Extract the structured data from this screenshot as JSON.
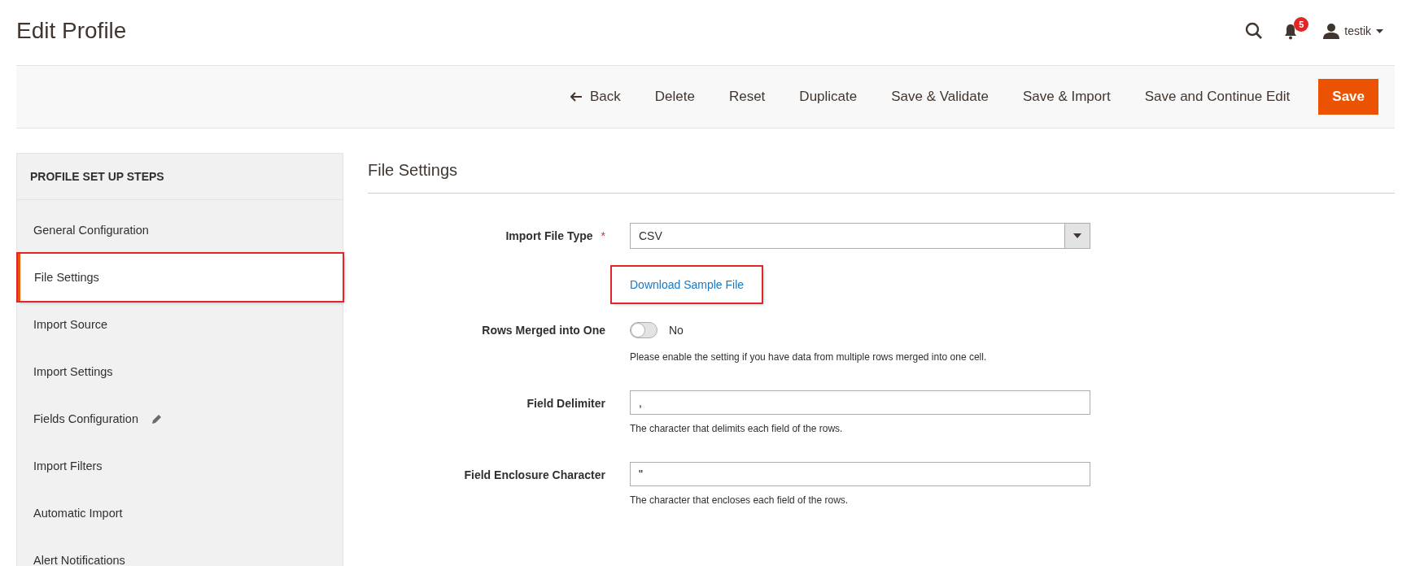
{
  "page_title": "Edit Profile",
  "header": {
    "notification_count": "5",
    "user": "testik"
  },
  "toolbar": {
    "back": "Back",
    "buttons": [
      {
        "label": "Delete",
        "kind": "plain"
      },
      {
        "label": "Reset",
        "kind": "plain"
      },
      {
        "label": "Duplicate",
        "kind": "plain"
      },
      {
        "label": "Save & Validate",
        "kind": "plain"
      },
      {
        "label": "Save & Import",
        "kind": "plain"
      },
      {
        "label": "Save and Continue Edit",
        "kind": "plain"
      },
      {
        "label": "Save",
        "kind": "primary"
      }
    ]
  },
  "sidebar": {
    "title": "PROFILE SET UP STEPS",
    "items": [
      {
        "label": "General Configuration",
        "selected": false,
        "edited": false,
        "highlighted": false
      },
      {
        "label": "File Settings",
        "selected": true,
        "edited": false,
        "highlighted": true
      },
      {
        "label": "Import Source",
        "selected": false,
        "edited": false,
        "highlighted": false
      },
      {
        "label": "Import Settings",
        "selected": false,
        "edited": false,
        "highlighted": false
      },
      {
        "label": "Fields Configuration",
        "selected": false,
        "edited": true,
        "highlighted": false
      },
      {
        "label": "Import Filters",
        "selected": false,
        "edited": false,
        "highlighted": false
      },
      {
        "label": "Automatic Import",
        "selected": false,
        "edited": false,
        "highlighted": false
      },
      {
        "label": "Alert Notifications",
        "selected": false,
        "edited": false,
        "highlighted": false
      }
    ]
  },
  "section": {
    "title": "File Settings",
    "fields": [
      {
        "kind": "select",
        "label": "Import File Type",
        "required_mark": "*",
        "value": "CSV"
      },
      {
        "kind": "link",
        "text": "Download Sample File",
        "highlighted": true
      },
      {
        "kind": "toggle",
        "label": "Rows Merged into One",
        "on": false,
        "value": "No",
        "note": "Please enable the setting if you have data from multiple rows merged into one cell."
      },
      {
        "kind": "text",
        "label": "Field Delimiter",
        "value": ",",
        "note": "The character that delimits each field of the rows."
      },
      {
        "kind": "text",
        "label": "Field Enclosure Character",
        "value": "\"",
        "note": "The character that encloses each field of the rows."
      }
    ]
  }
}
